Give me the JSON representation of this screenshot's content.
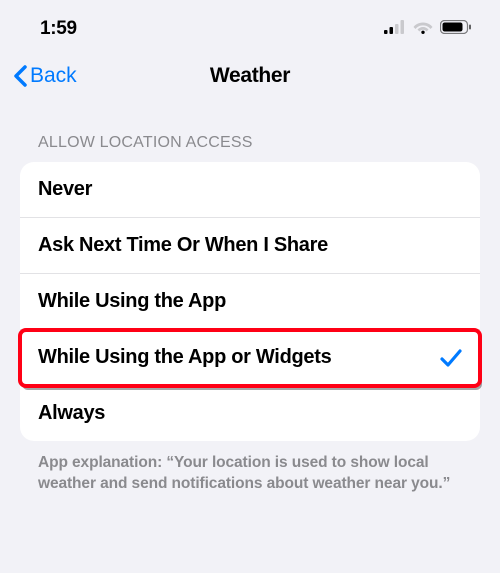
{
  "status_bar": {
    "time": "1:59"
  },
  "nav": {
    "back_label": "Back",
    "title": "Weather"
  },
  "section": {
    "header": "ALLOW LOCATION ACCESS",
    "options": [
      {
        "label": "Never",
        "selected": false,
        "highlighted": false
      },
      {
        "label": "Ask Next Time Or When I Share",
        "selected": false,
        "highlighted": false
      },
      {
        "label": "While Using the App",
        "selected": false,
        "highlighted": false
      },
      {
        "label": "While Using the App or Widgets",
        "selected": true,
        "highlighted": true
      },
      {
        "label": "Always",
        "selected": false,
        "highlighted": false
      }
    ],
    "footer": "App explanation: “Your location is used to show local weather and send notifications about weather near you.”"
  }
}
